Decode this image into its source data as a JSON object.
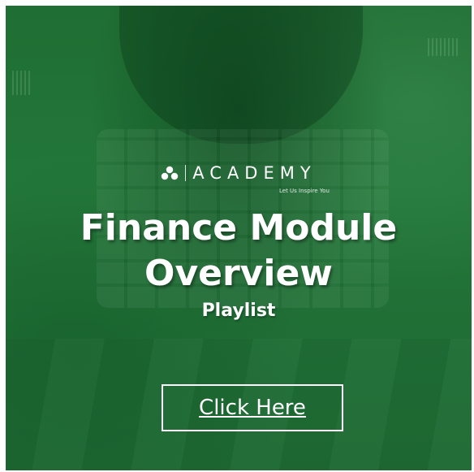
{
  "banner": {
    "brand": {
      "name": "ACADEMY",
      "tagline": "Let Us Inspire You",
      "logo_icon": "tri-circle-logo-icon"
    },
    "title_line1": "Finance Module",
    "title_line2": "Overview",
    "subtitle": "Playlist",
    "cta_label": "Click Here",
    "colors": {
      "background": "#217236",
      "text": "#ffffff",
      "cta_border": "#ffffff"
    }
  }
}
